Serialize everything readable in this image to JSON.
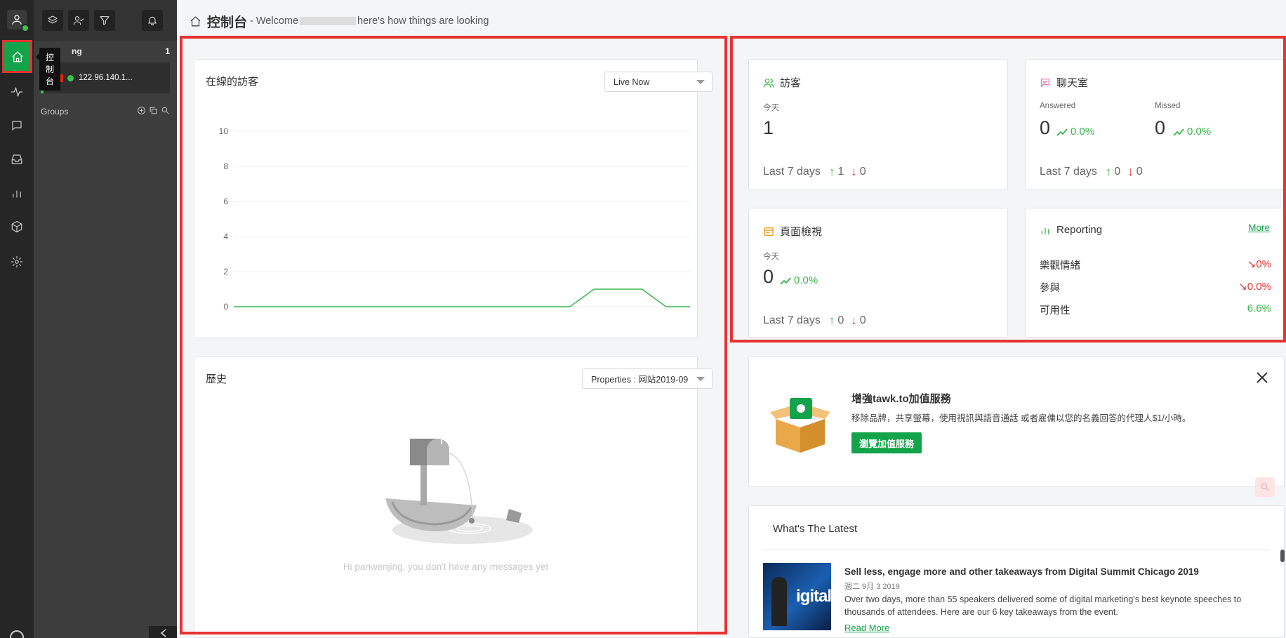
{
  "sidebar": {
    "tooltip": "控制台",
    "section_label": "ng",
    "section_count": "1",
    "visitor_ip": "122.96.140.1...",
    "groups_label": "Groups"
  },
  "header": {
    "title": "控制台",
    "welcome_prefix": " - Welcome",
    "welcome_suffix": "here's how things are looking"
  },
  "online": {
    "title": "在線的訪客",
    "select_value": "Live Now"
  },
  "history": {
    "title": "歷史",
    "select_value": "Properties : 网站2019-09",
    "empty_message": "Hi panwenjing, you don't have any messages yet"
  },
  "visitors": {
    "title": "訪客",
    "today_label": "今天",
    "today_value": "1",
    "last7_label": "Last 7 days",
    "last7_up": "1",
    "last7_down": "0"
  },
  "chats": {
    "title": "聊天室",
    "answered_label": "Answered",
    "answered_value": "0",
    "answered_trend": "0.0%",
    "missed_label": "Missed",
    "missed_value": "0",
    "missed_trend": "0.0%",
    "last7_label": "Last 7 days",
    "last7_up": "0",
    "last7_down": "0"
  },
  "pageviews": {
    "title": "頁面檢視",
    "today_label": "今天",
    "today_value": "0",
    "today_trend": "0.0%",
    "last7_label": "Last 7 days",
    "last7_up": "0",
    "last7_down": "0"
  },
  "reporting": {
    "title": "Reporting",
    "more_label": "More",
    "rows": [
      {
        "label": "樂觀情緒",
        "value": "0%"
      },
      {
        "label": "參與",
        "value": "0.0%"
      },
      {
        "label": "可用性",
        "value": "6.6%"
      }
    ]
  },
  "promo": {
    "title": "增強tawk.to加值服務",
    "text": "移除品牌，共享螢幕，使用視訊與語音通話 或者雇傭以您的名義回答的代理人$1/小時。",
    "button": "瀏覽加值服務"
  },
  "latest": {
    "title": "What's The Latest",
    "thumb_text": "igital",
    "news_title": "Sell less, engage more and other takeaways from Digital Summit Chicago 2019",
    "news_date": "週二 9月 3 2019",
    "news_body": "Over two days, more than 55 speakers delivered some of digital marketing's best keynote speeches to thousands of attendees. Here are our 6 key takeaways from the event.",
    "read_more": "Read More"
  },
  "colors": {
    "brand_green": "#13a34a",
    "up_green": "#39b54a",
    "down_red": "#e63333",
    "highlight_red": "#e63333"
  },
  "chart_data": {
    "type": "line",
    "x": [
      0,
      1,
      2,
      3,
      4,
      5,
      6,
      7,
      8,
      9,
      10,
      11,
      12,
      13,
      14,
      15,
      16,
      17,
      18,
      19
    ],
    "series": [
      {
        "values": [
          0,
          0,
          0,
          0,
          0,
          0,
          0,
          0,
          0,
          0,
          0,
          0,
          0,
          0,
          0,
          1,
          1,
          1,
          0,
          0
        ]
      }
    ],
    "y_ticks": [
      0,
      2,
      4,
      6,
      8,
      10
    ],
    "ylim": [
      0,
      10
    ],
    "grid": true,
    "line_color": "#39b54a"
  }
}
